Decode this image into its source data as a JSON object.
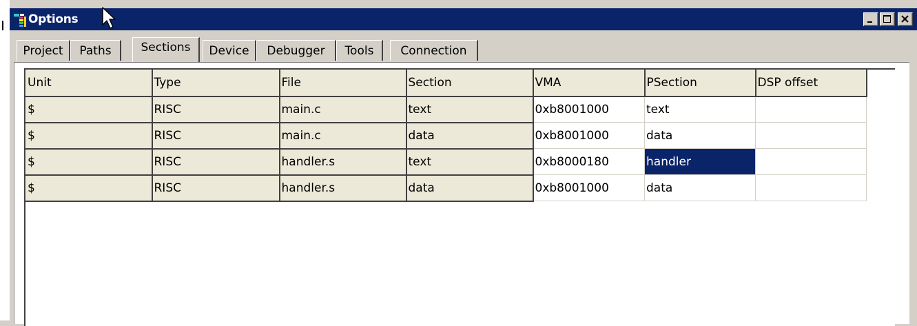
{
  "window": {
    "title": "Options"
  },
  "tabs": [
    {
      "label": "Project"
    },
    {
      "label": "Paths"
    },
    {
      "label": "Sections"
    },
    {
      "label": "Device"
    },
    {
      "label": "Debugger"
    },
    {
      "label": "Tools"
    },
    {
      "label": "Connection"
    }
  ],
  "active_tab": "Sections",
  "colors": {
    "titlebar": "#0a246a",
    "selection": "#0a246a",
    "face": "#d4d0c8",
    "fixed_cell": "#ece9d8"
  },
  "grid": {
    "columns": [
      "Unit",
      "Type",
      "File",
      "Section",
      "VMA",
      "PSection",
      "DSP offset"
    ],
    "rows": [
      [
        "$",
        "RISC",
        "main.c",
        "text",
        "0xb8001000",
        "text",
        ""
      ],
      [
        "$",
        "RISC",
        "main.c",
        "data",
        "0xb8001000",
        "data",
        ""
      ],
      [
        "$",
        "RISC",
        "handler.s",
        "text",
        "0xb8000180",
        "handler",
        ""
      ],
      [
        "$",
        "RISC",
        "handler.s",
        "data",
        "0xb8001000",
        "data",
        ""
      ]
    ],
    "selected_cell": {
      "row": 2,
      "column": "PSection"
    }
  }
}
